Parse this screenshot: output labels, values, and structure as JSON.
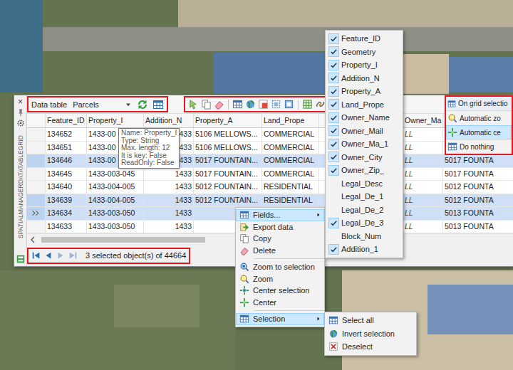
{
  "panel": {
    "title": "SPATIALMANAGERDATATABLEGRID",
    "close": "×"
  },
  "toolbar": {
    "label": "Data table",
    "table": "Parcels"
  },
  "table": {
    "columns": [
      "Feature_ID",
      "Property_I",
      "Addition_N",
      "Property_A",
      "Land_Prope",
      "Owner_Ma"
    ],
    "rows": [
      {
        "cells": [
          "134652",
          "1433-00",
          "1433",
          "5106 MELLOWS...",
          "COMMERCIAL",
          "LL"
        ],
        "selected": false,
        "current": false
      },
      {
        "cells": [
          "134651",
          "1433-00",
          "1433",
          "5106 MELLOWS...",
          "COMMERCIAL",
          "LL"
        ],
        "selected": false,
        "current": false
      },
      {
        "cells": [
          "134646",
          "1433-00",
          "1433",
          "5017 FOUNTAIN...",
          "COMMERCIAL",
          "LL"
        ],
        "extra": "5017 FOUNTA",
        "selected": true,
        "current": false
      },
      {
        "cells": [
          "134645",
          "1433-003-045",
          "1433",
          "5017 FOUNTAIN...",
          "COMMERCIAL",
          "LL"
        ],
        "extra": "5017 FOUNTA",
        "selected": false,
        "current": false
      },
      {
        "cells": [
          "134640",
          "1433-004-005",
          "1433",
          "5012 FOUNTAIN...",
          "RESIDENTIAL",
          "LL"
        ],
        "extra": "5012 FOUNTA",
        "selected": false,
        "current": false
      },
      {
        "cells": [
          "134639",
          "1433-004-005",
          "1433",
          "5012 FOUNTAIN...",
          "RESIDENTIAL",
          "LL"
        ],
        "extra": "5012 FOUNTA",
        "selected": true,
        "current": false
      },
      {
        "cells": [
          "134634",
          "1433-003-050",
          "1433",
          null,
          null,
          "LL"
        ],
        "extra": "5013 FOUNTA",
        "selected": true,
        "current": true
      },
      {
        "cells": [
          "134633",
          "1433-003-050",
          "1433",
          null,
          null,
          "LL"
        ],
        "extra": "5013 FOUNTA",
        "selected": false,
        "current": false
      }
    ]
  },
  "tooltip": {
    "lines": [
      "Name: Property_I",
      "Type: String",
      "Max. length: 12",
      "It is key: False",
      "ReadOnly: False"
    ]
  },
  "status": {
    "nav": [
      {
        "disabled": false
      },
      {
        "disabled": false
      },
      {
        "disabled": true
      },
      {
        "disabled": true
      }
    ],
    "text": "3 selected object(s) of 44664"
  },
  "context_menu": {
    "items": [
      {
        "kind": "item",
        "label": "Fields...",
        "highlighted": true,
        "submenu": true
      },
      {
        "kind": "item",
        "label": "Export data",
        "highlighted": false,
        "submenu": false
      },
      {
        "kind": "item",
        "label": "Copy",
        "highlighted": false,
        "submenu": false
      },
      {
        "kind": "item",
        "label": "Delete",
        "highlighted": false,
        "submenu": false
      },
      {
        "kind": "separator"
      },
      {
        "kind": "item",
        "label": "Zoom to selection",
        "highlighted": false,
        "submenu": false
      },
      {
        "kind": "item",
        "label": "Zoom",
        "highlighted": false,
        "submenu": false
      },
      {
        "kind": "item",
        "label": "Center selection",
        "highlighted": false,
        "submenu": false
      },
      {
        "kind": "item",
        "label": "Center",
        "highlighted": false,
        "submenu": false
      },
      {
        "kind": "separator"
      },
      {
        "kind": "item",
        "label": "Selection",
        "highlighted": true,
        "submenu": true
      }
    ]
  },
  "fields_menu": {
    "items": [
      {
        "label": "Feature_ID",
        "checked": true
      },
      {
        "label": "Geometry",
        "checked": true
      },
      {
        "label": "Property_I",
        "checked": true
      },
      {
        "label": "Addition_N",
        "checked": true
      },
      {
        "label": "Property_A",
        "checked": true
      },
      {
        "label": "Land_Prope",
        "checked": true
      },
      {
        "label": "Owner_Name",
        "checked": true
      },
      {
        "label": "Owner_Mail",
        "checked": true
      },
      {
        "label": "Owner_Ma_1",
        "checked": true
      },
      {
        "label": "Owner_City",
        "checked": true
      },
      {
        "label": "Owner_Zip_",
        "checked": true
      },
      {
        "label": "Legal_Desc",
        "checked": false
      },
      {
        "label": "Legal_De_1",
        "checked": false
      },
      {
        "label": "Legal_De_2",
        "checked": false
      },
      {
        "label": "Legal_De_3",
        "checked": true
      },
      {
        "label": "Block_Num",
        "checked": false
      },
      {
        "label": "Addition_1",
        "checked": true
      }
    ]
  },
  "selection_menu": {
    "items": [
      {
        "label": "Select all"
      },
      {
        "label": "Invert selection"
      },
      {
        "label": "Deselect"
      }
    ]
  },
  "on_grid_menu": {
    "title": "On grid selectio",
    "items": [
      {
        "label": "Automatic zo",
        "selected": false
      },
      {
        "label": "Automatic ce",
        "selected": true
      },
      {
        "label": "Do nothing",
        "selected": false
      }
    ]
  }
}
